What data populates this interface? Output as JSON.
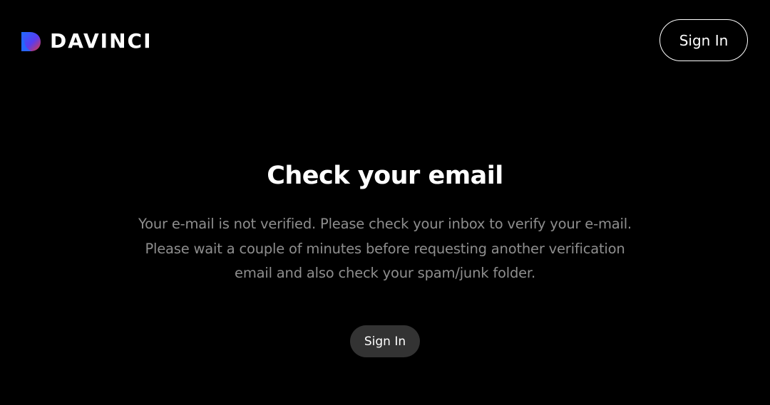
{
  "header": {
    "brand": "DAVINCI",
    "logo_icon": "davinci-d-logo-icon",
    "sign_in_label": "Sign In"
  },
  "main": {
    "title": "Check your email",
    "message": "Your e-mail is not verified. Please check your inbox to verify your e-mail. Please wait a couple of minutes before requesting another verification email and also check your spam/junk folder.",
    "sign_in_label": "Sign In"
  },
  "colors": {
    "background": "#000000",
    "text_primary": "#ffffff",
    "text_secondary": "#8e8e8e",
    "button_filled": "#333333",
    "logo_gradient_start": "#1e6bff",
    "logo_gradient_end": "#e23a3a"
  }
}
